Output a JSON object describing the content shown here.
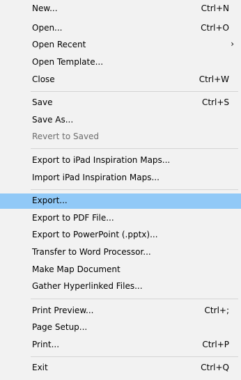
{
  "menu": {
    "items": [
      {
        "label": "New...",
        "shortcut": "Ctrl+N"
      },
      {
        "label": "Open...",
        "shortcut": "Ctrl+O"
      },
      {
        "label": "Open Recent",
        "submenu": "›"
      },
      {
        "label": "Open Template..."
      },
      {
        "label": "Close",
        "shortcut": "Ctrl+W"
      },
      {
        "label": "Save",
        "shortcut": "Ctrl+S"
      },
      {
        "label": "Save As..."
      },
      {
        "label": "Revert to Saved"
      },
      {
        "label": "Export to iPad Inspiration Maps..."
      },
      {
        "label": "Import iPad Inspiration Maps..."
      },
      {
        "label": "Export..."
      },
      {
        "label": "Export to PDF File..."
      },
      {
        "label": "Export to PowerPoint (.pptx)..."
      },
      {
        "label": "Transfer to Word Processor..."
      },
      {
        "label": "Make Map Document"
      },
      {
        "label": "Gather Hyperlinked Files..."
      },
      {
        "label": "Print Preview...",
        "shortcut": "Ctrl+;"
      },
      {
        "label": "Page Setup..."
      },
      {
        "label": "Print...",
        "shortcut": "Ctrl+P"
      },
      {
        "label": "Exit",
        "shortcut": "Ctrl+Q"
      }
    ]
  }
}
